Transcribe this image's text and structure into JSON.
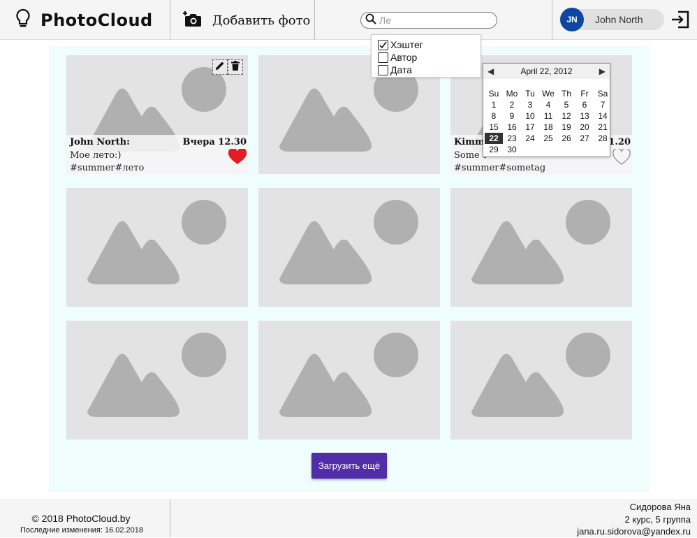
{
  "header": {
    "brand": "PhotoCloud",
    "add_photo_label": "Добавить фото",
    "search": {
      "value": "Ле"
    },
    "filters": [
      {
        "label": "Хэштег",
        "checked": true
      },
      {
        "label": "Автор",
        "checked": false
      },
      {
        "label": "Дата",
        "checked": false
      }
    ],
    "user": {
      "initials": "JN",
      "name": "John North"
    }
  },
  "posts": [
    {
      "author": "John North:",
      "date": "Вчера 12.30",
      "text": "Мое лето:)",
      "tags": "#summer#лето",
      "liked": true,
      "editable": true
    },
    {
      "author": "",
      "date": "",
      "text": "",
      "tags": "",
      "liked": false,
      "editable": false
    },
    {
      "author": "Kimmy",
      "date": "21.20",
      "text": "Some t",
      "tags": "#summer#sometag",
      "liked": false,
      "editable": false
    },
    {
      "author": "",
      "date": "",
      "text": "",
      "tags": ""
    },
    {
      "author": "",
      "date": "",
      "text": "",
      "tags": ""
    },
    {
      "author": "",
      "date": "",
      "text": "",
      "tags": ""
    },
    {
      "author": "",
      "date": "",
      "text": "",
      "tags": ""
    },
    {
      "author": "",
      "date": "",
      "text": "",
      "tags": ""
    },
    {
      "author": "",
      "date": "",
      "text": "",
      "tags": ""
    }
  ],
  "calendar": {
    "title": "April 22, 2012",
    "prev": "◀",
    "next": "▶",
    "weekdays": [
      "Su",
      "Mo",
      "Tu",
      "We",
      "Th",
      "Fr",
      "Sa"
    ],
    "days": [
      "1",
      "2",
      "3",
      "4",
      "5",
      "6",
      "7",
      "8",
      "9",
      "10",
      "11",
      "12",
      "13",
      "14",
      "15",
      "16",
      "17",
      "18",
      "19",
      "20",
      "21",
      "22",
      "23",
      "24",
      "25",
      "26",
      "27",
      "28",
      "29",
      "30"
    ],
    "selected": "22"
  },
  "load_more_label": "Загрузить ещё",
  "footer": {
    "copyright": "© 2018 PhotoCloud.by",
    "last_modified": "Последние изменения: 16.02.2018",
    "author_name": "Сидорова Яна",
    "course": "2 курс, 5 группа",
    "email": "jana.ru.sidorova@yandex.ru"
  },
  "colors": {
    "accent": "#512da8",
    "avatar": "#0d47a1",
    "heart_liked": "#e51c23",
    "main_bg": "#f0fdfd"
  }
}
